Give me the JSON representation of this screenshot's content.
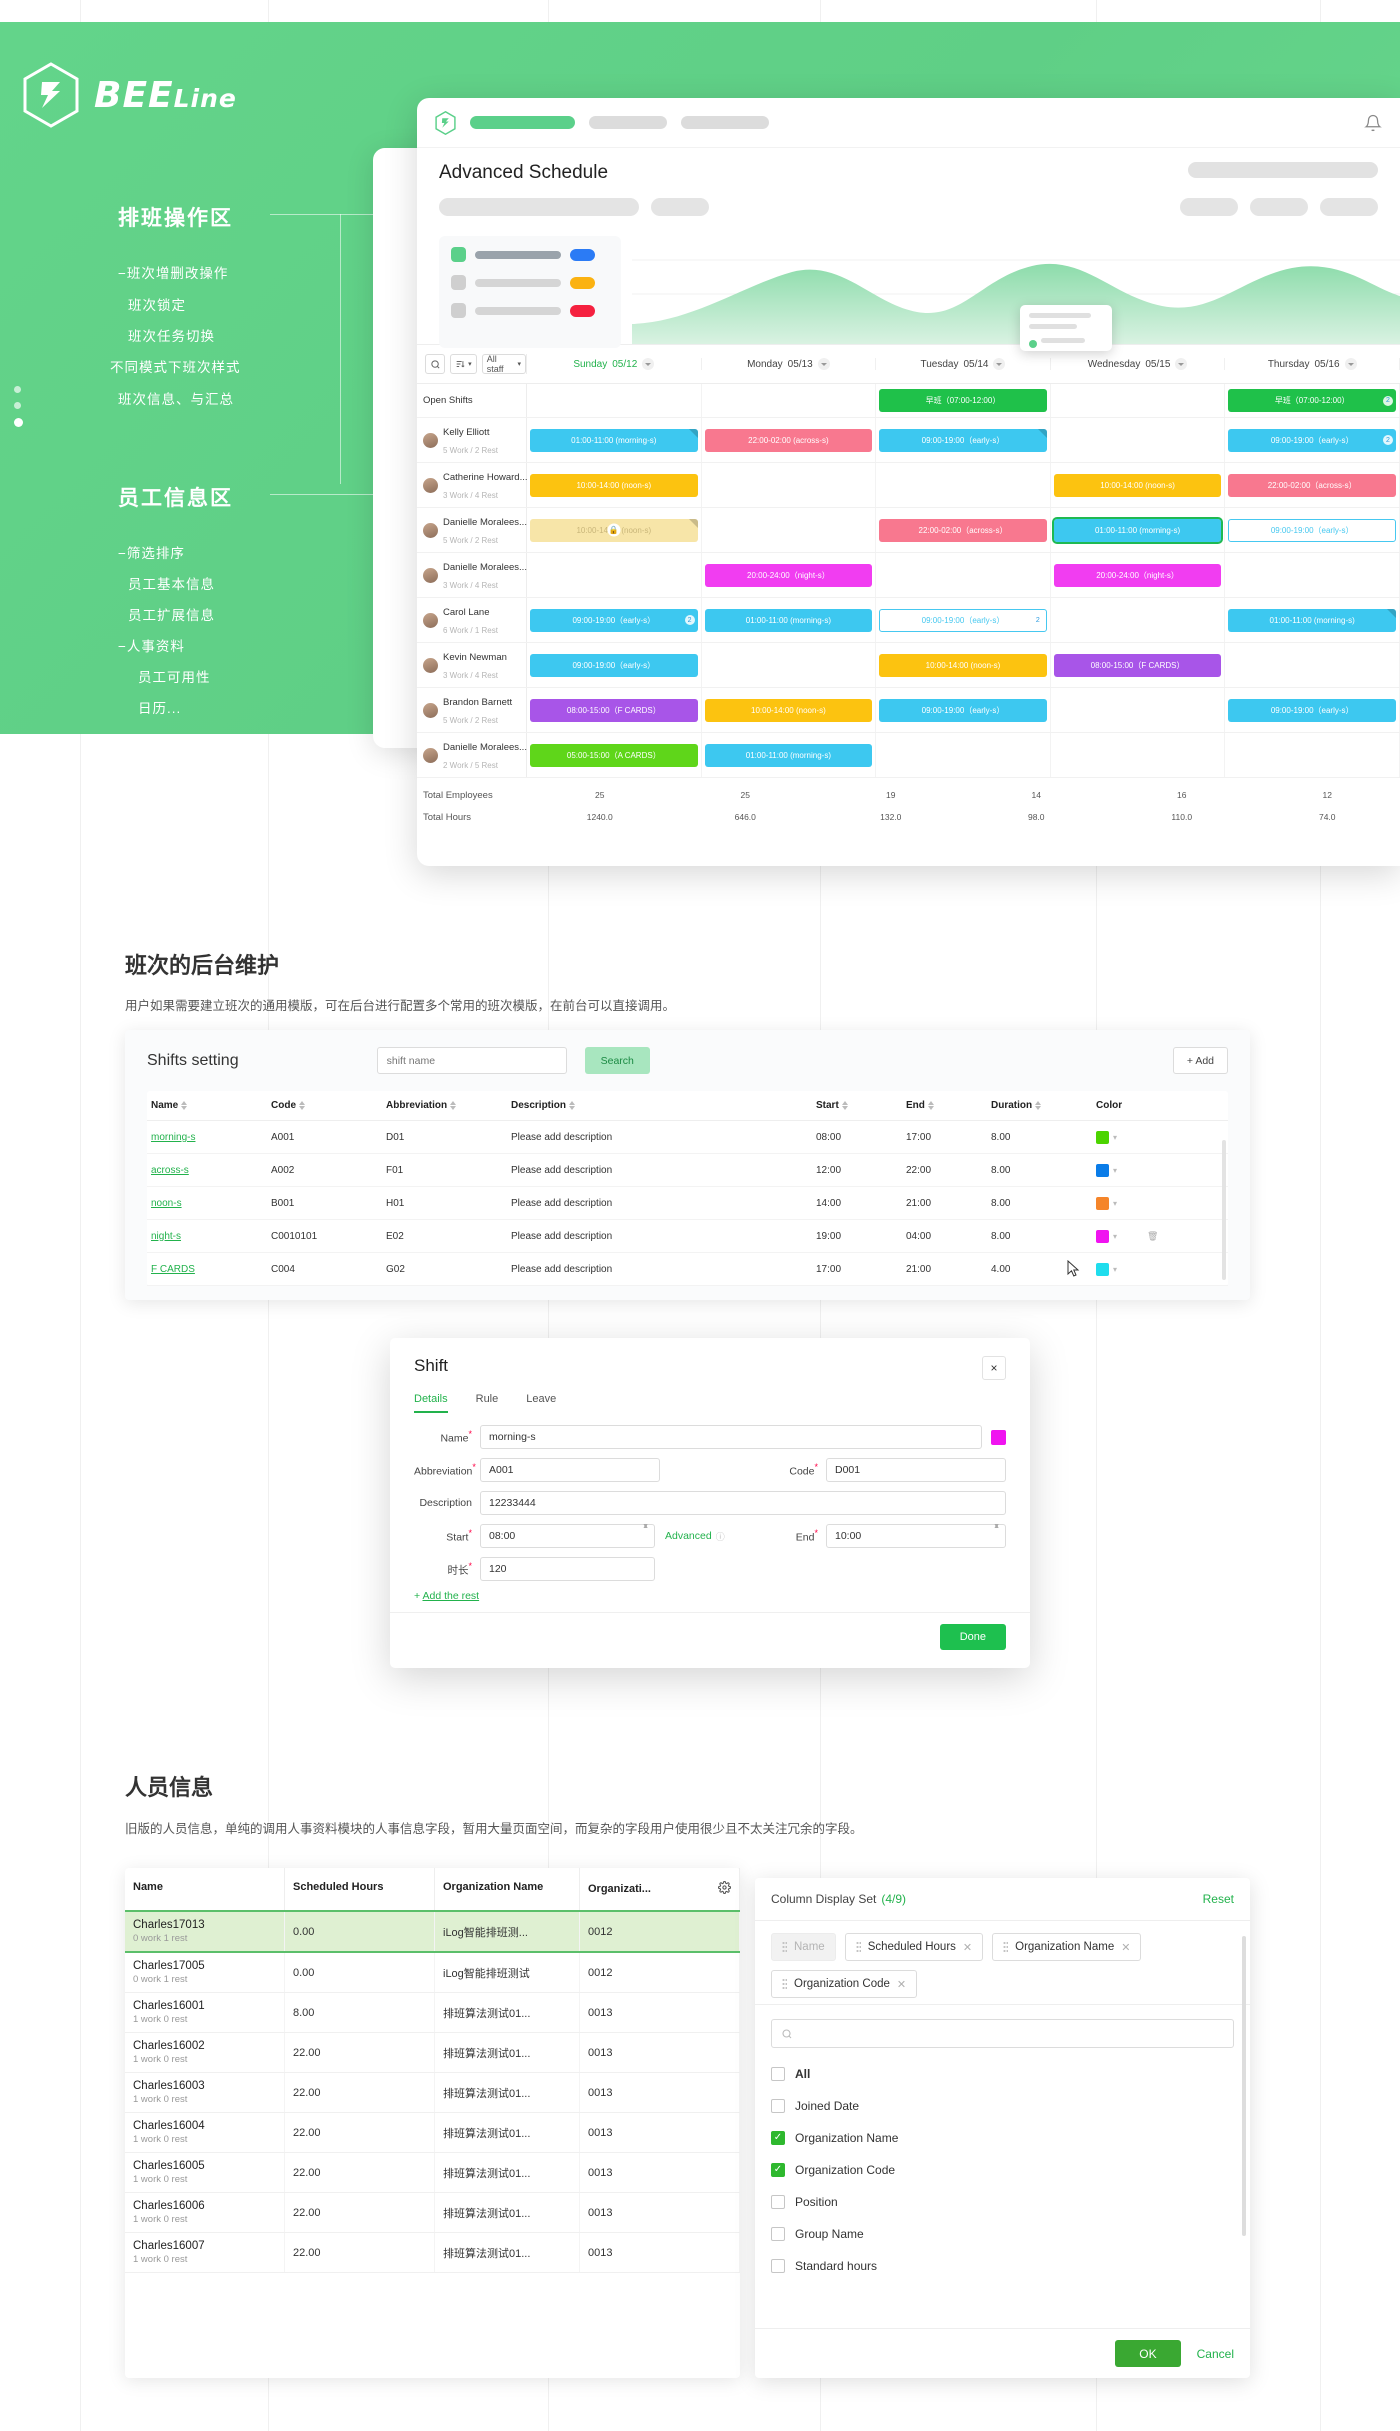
{
  "brand": {
    "name": "BEE",
    "suffix": "Line"
  },
  "hero": {
    "section1": {
      "title": "排班操作区",
      "items": [
        "−班次增删改操作",
        "班次锁定",
        "班次任务切换",
        "不同模式下班次样式",
        "班次信息、与汇总"
      ]
    },
    "section2": {
      "title": "员工信息区",
      "items": [
        "−筛选排序",
        "员工基本信息",
        "员工扩展信息",
        "−人事资料",
        "员工可用性",
        "日历..."
      ]
    }
  },
  "schedule": {
    "title": "Advanced Schedule",
    "toolbar": {
      "search_icon": "search-icon",
      "sort_icon": "sort-icon",
      "staff_filter": "All staff"
    },
    "days": [
      {
        "name": "Sunday",
        "date": "05/12",
        "active": true
      },
      {
        "name": "Monday",
        "date": "05/13",
        "active": false
      },
      {
        "name": "Tuesday",
        "date": "05/14",
        "active": false
      },
      {
        "name": "Wednesday",
        "date": "05/15",
        "active": false
      },
      {
        "name": "Thursday",
        "date": "05/16",
        "active": false
      }
    ],
    "open_shifts_label": "Open Shifts",
    "open_shifts": [
      {
        "text": "",
        "color": ""
      },
      {
        "text": "",
        "color": ""
      },
      {
        "text": "早班（07:00-12:00）",
        "color": "#1fc14a"
      },
      {
        "text": "",
        "color": ""
      },
      {
        "text": "早班（07:00-12:00）",
        "color": "#1fc14a",
        "count": "2"
      }
    ],
    "employees": [
      {
        "name": "Kelly Elliott",
        "sub": "5 Work / 2 Rest",
        "cells": [
          {
            "text": "01:00-11:00 (morning-s)",
            "color": "#3dc8f0",
            "corner": true
          },
          {
            "text": "22:00-02:00 (across-s)",
            "color": "#f8788f"
          },
          {
            "text": "09:00-19:00（early-s）",
            "color": "#3dc8f0",
            "corner": true
          },
          {
            "text": ""
          },
          {
            "text": "09:00-19:00（early-s）",
            "color": "#3dc8f0",
            "count": "2"
          }
        ]
      },
      {
        "name": "Catherine Howard...",
        "sub": "3 Work / 4 Rest",
        "cells": [
          {
            "text": "10:00-14:00 (noon-s)",
            "color": "#fcc310"
          },
          {
            "text": ""
          },
          {
            "text": ""
          },
          {
            "text": "10:00-14:00 (noon-s)",
            "color": "#fcc310"
          },
          {
            "text": "22:00-02:00（across-s）",
            "color": "#f8788f"
          }
        ]
      },
      {
        "name": "Danielle Moralees...",
        "sub": "5 Work / 2 Rest",
        "cells": [
          {
            "text": "10:00-14:00 (noon-s)",
            "color": "#f7e5a8",
            "corner": true,
            "locked": true
          },
          {
            "text": ""
          },
          {
            "text": "22:00-02:00（across-s）",
            "color": "#f8788f"
          },
          {
            "text": "01:00-11:00 (morning-s)",
            "color": "#3dc8f0",
            "selected": true
          },
          {
            "text": "09:00-19:00（early-s）",
            "color": "#3dc8f0",
            "ghost": true
          }
        ]
      },
      {
        "name": "Danielle Moralees...",
        "sub": "3 Work / 4 Rest",
        "cells": [
          {
            "text": ""
          },
          {
            "text": "20:00-24:00（night-s）",
            "color": "#f13df1",
            "stripe": true
          },
          {
            "text": ""
          },
          {
            "text": "20:00-24:00（night-s）",
            "color": "#f13df1"
          },
          {
            "text": ""
          }
        ]
      },
      {
        "name": "Carol Lane",
        "sub": "6 Work / 1 Rest",
        "cells": [
          {
            "text": "09:00-19:00（early-s）",
            "color": "#3dc8f0",
            "count": "2"
          },
          {
            "text": "01:00-11:00 (morning-s)",
            "color": "#3dc8f0"
          },
          {
            "text": "09:00-19:00（early-s）",
            "color": "#3dc8f0",
            "ghost": true,
            "count": "2"
          },
          {
            "text": ""
          },
          {
            "text": "01:00-11:00 (morning-s)",
            "color": "#3dc8f0",
            "corner": true
          }
        ]
      },
      {
        "name": "Kevin Newman",
        "sub": "3 Work / 4 Rest",
        "cells": [
          {
            "text": "09:00-19:00（early-s）",
            "color": "#3dc8f0"
          },
          {
            "text": ""
          },
          {
            "text": "10:00-14:00 (noon-s)",
            "color": "#fcc310"
          },
          {
            "text": "08:00-15:00（F CARDS）",
            "color": "#a855e8"
          },
          {
            "text": ""
          }
        ]
      },
      {
        "name": "Brandon Barnett",
        "sub": "5 Work / 2 Rest",
        "cells": [
          {
            "text": "08:00-15:00（F CARDS）",
            "color": "#a855e8"
          },
          {
            "text": "10:00-14:00 (noon-s)",
            "color": "#fcc310"
          },
          {
            "text": "09:00-19:00（early-s）",
            "color": "#3dc8f0"
          },
          {
            "text": ""
          },
          {
            "text": "09:00-19:00（early-s）",
            "color": "#3dc8f0"
          }
        ]
      },
      {
        "name": "Danielle Moralees...",
        "sub": "2 Work / 5 Rest",
        "cells": [
          {
            "text": "05:00-15:00（A CARDS）",
            "color": "#5fd61a"
          },
          {
            "text": "01:00-11:00 (morning-s)",
            "color": "#3dc8f0"
          },
          {
            "text": ""
          },
          {
            "text": ""
          },
          {
            "text": ""
          }
        ]
      }
    ],
    "totals": {
      "employees_label": "Total Employees",
      "hours_label": "Total Hours",
      "employees": [
        "25",
        "25",
        "19",
        "14",
        "16",
        "12"
      ],
      "hours": [
        "1240.0",
        "646.0",
        "132.0",
        "98.0",
        "110.0",
        "74.0"
      ]
    }
  },
  "shifts_section": {
    "heading": "班次的后台维护",
    "paragraph": "用户如果需要建立班次的通用模版，可在后台进行配置多个常用的班次模版，在前台可以直接调用。",
    "card_title": "Shifts setting",
    "search_placeholder": "shift name",
    "search_button": "Search",
    "add_button": "Add",
    "columns": [
      "Name",
      "Code",
      "Abbreviation",
      "Description",
      "Start",
      "End",
      "Duration",
      "Color"
    ],
    "rows": [
      {
        "name": "morning-s",
        "code": "A001",
        "abbr": "D01",
        "desc": "Please add description",
        "start": "08:00",
        "end": "17:00",
        "duration": "8.00",
        "color": "#4cd400"
      },
      {
        "name": "across-s",
        "code": "A002",
        "abbr": "F01",
        "desc": "Please add description",
        "start": "12:00",
        "end": "22:00",
        "duration": "8.00",
        "color": "#0a7ce8"
      },
      {
        "name": "noon-s",
        "code": "B001",
        "abbr": "H01",
        "desc": "Please add description",
        "start": "14:00",
        "end": "21:00",
        "duration": "8.00",
        "color": "#f5852a"
      },
      {
        "name": "night-s",
        "code": "C0010101",
        "abbr": "E02",
        "desc": "Please add description",
        "start": "19:00",
        "end": "04:00",
        "duration": "8.00",
        "color": "#f013f0"
      },
      {
        "name": "F CARDS",
        "code": "C004",
        "abbr": "G02",
        "desc": "Please add description",
        "start": "17:00",
        "end": "21:00",
        "duration": "4.00",
        "color": "#1fdded"
      }
    ]
  },
  "shift_modal": {
    "title": "Shift",
    "close": "×",
    "tabs": [
      "Details",
      "Rule",
      "Leave"
    ],
    "active_tab": "Details",
    "fields": {
      "name_label": "Name",
      "name_value": "morning-s",
      "name_color": "#f013f0",
      "abbr_label": "Abbreviation",
      "abbr_value": "A001",
      "code_label": "Code",
      "code_value": "D001",
      "desc_label": "Description",
      "desc_value": "12233444",
      "start_label": "Start",
      "start_value": "08:00",
      "advanced_label": "Advanced",
      "end_label": "End",
      "end_value": "10:00",
      "duration_label": "时长",
      "duration_value": "120"
    },
    "add_rest": "Add the rest",
    "done": "Done"
  },
  "people_section": {
    "heading": "人员信息",
    "paragraph": "旧版的人员信息，单纯的调用人事资料模块的人事信息字段，暂用大量页面空间，而复杂的字段用户使用很少且不太关注冗余的字段。",
    "columns": [
      "Name",
      "Scheduled Hours",
      "Organization Name",
      "Organizati..."
    ],
    "gear_icon": "gear-icon",
    "rows": [
      {
        "name": "Charles17013",
        "wr": "0 work 1 rest",
        "hours": "0.00",
        "org": "iLog智能排班测...",
        "code": "0012",
        "highlight": true
      },
      {
        "name": "Charles17005",
        "wr": "0 work 1 rest",
        "hours": "0.00",
        "org": "iLog智能排班测试",
        "code": "0012"
      },
      {
        "name": "Charles16001",
        "wr": "1 work 0 rest",
        "hours": "8.00",
        "org": "排班算法测试01...",
        "code": "0013"
      },
      {
        "name": "Charles16002",
        "wr": "1 work 0 rest",
        "hours": "22.00",
        "org": "排班算法测试01...",
        "code": "0013"
      },
      {
        "name": "Charles16003",
        "wr": "1 work 0 rest",
        "hours": "22.00",
        "org": "排班算法测试01...",
        "code": "0013"
      },
      {
        "name": "Charles16004",
        "wr": "1 work 0 rest",
        "hours": "22.00",
        "org": "排班算法测试01...",
        "code": "0013"
      },
      {
        "name": "Charles16005",
        "wr": "1 work 0 rest",
        "hours": "22.00",
        "org": "排班算法测试01...",
        "code": "0013"
      },
      {
        "name": "Charles16006",
        "wr": "1 work 0 rest",
        "hours": "22.00",
        "org": "排班算法测试01...",
        "code": "0013"
      },
      {
        "name": "Charles16007",
        "wr": "1 work 0 rest",
        "hours": "22.00",
        "org": "排班算法测试01...",
        "code": "0013"
      }
    ]
  },
  "column_set": {
    "title": "Column Display Set",
    "count": "(4/9)",
    "reset": "Reset",
    "tags": [
      {
        "label": "Name",
        "disabled": true
      },
      {
        "label": "Scheduled Hours",
        "disabled": false
      },
      {
        "label": "Organization Name",
        "disabled": false
      },
      {
        "label": "Organization Code",
        "disabled": false
      }
    ],
    "search_placeholder": "",
    "options": [
      {
        "label": "All",
        "checked": false,
        "bold": true
      },
      {
        "label": "Joined Date",
        "checked": false
      },
      {
        "label": "Organization Name",
        "checked": true
      },
      {
        "label": "Organization Code",
        "checked": true
      },
      {
        "label": "Position",
        "checked": false
      },
      {
        "label": "Group Name",
        "checked": false
      },
      {
        "label": "Standard hours",
        "checked": false
      }
    ],
    "ok": "OK",
    "cancel": "Cancel"
  }
}
